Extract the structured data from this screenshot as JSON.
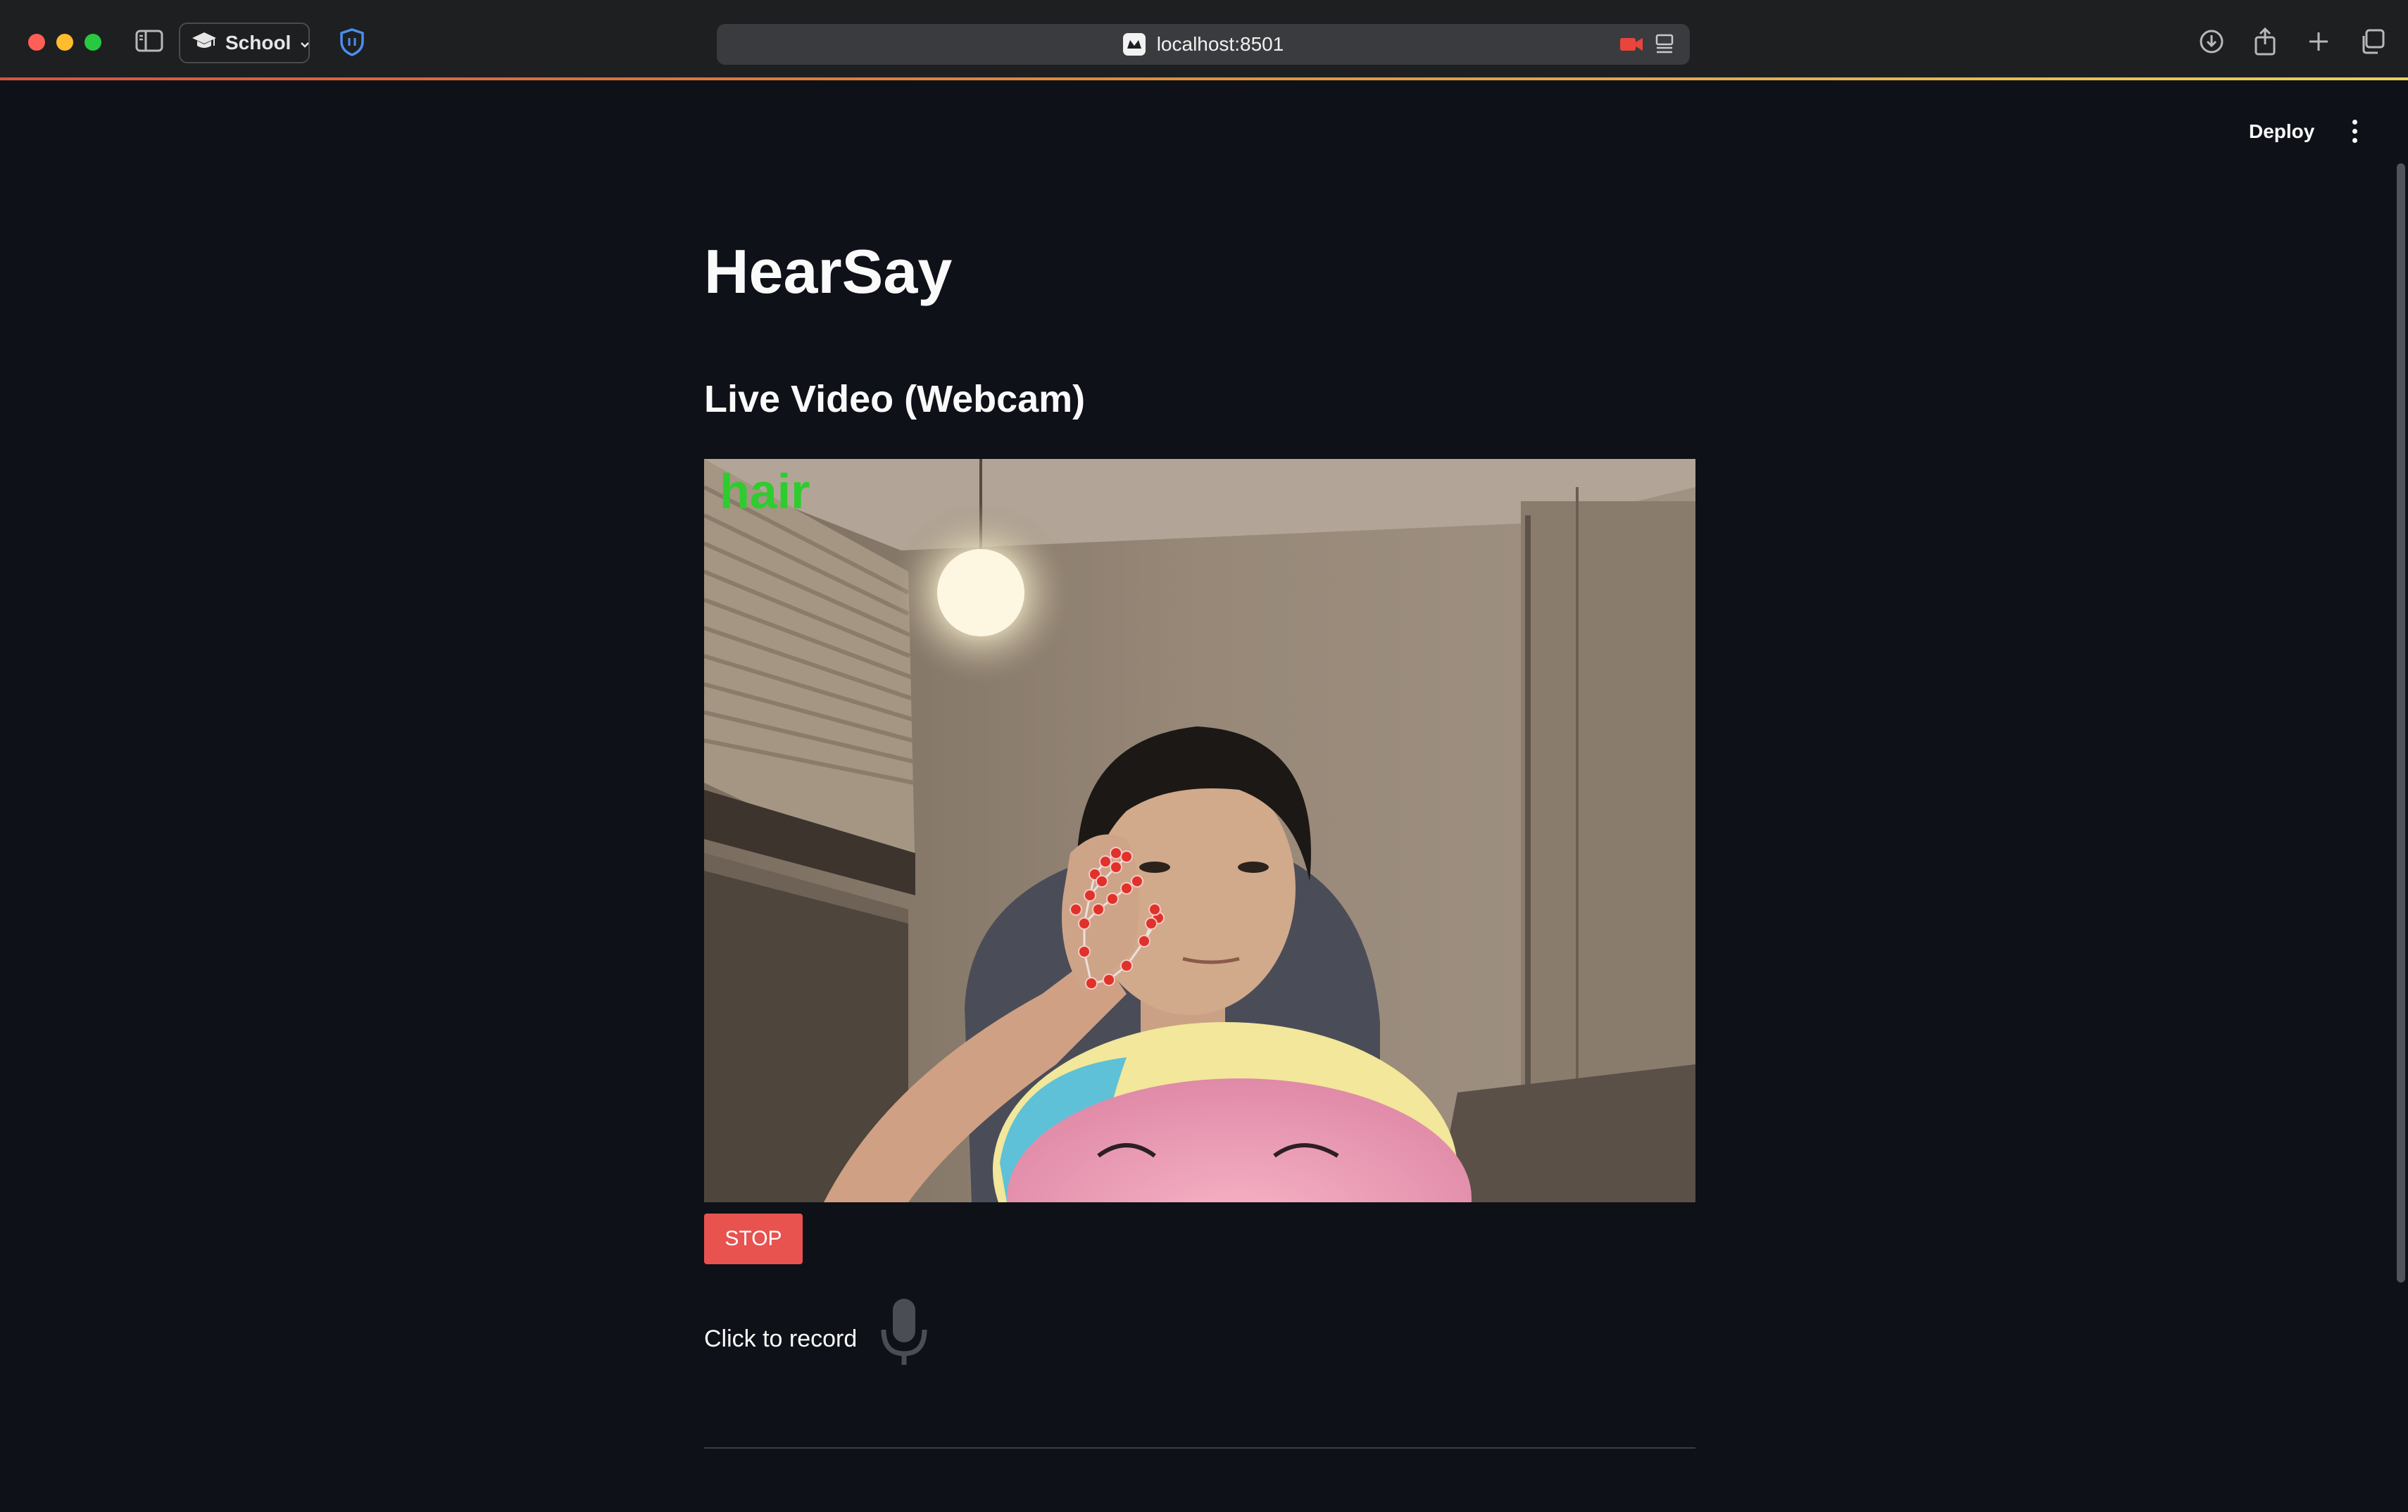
{
  "browser": {
    "profile_label": "School",
    "url": "localhost:8501"
  },
  "toolbar": {
    "deploy_label": "Deploy"
  },
  "main": {
    "title": "HearSay",
    "video_section_header": "Live Video (Webcam)",
    "prediction_overlay_text": "hair",
    "stop_button_label": "STOP",
    "record_label": "Click to record"
  },
  "colors": {
    "app_background": "#0e1117",
    "stop_button": "#e8524f",
    "prediction_text": "#2ecc2e",
    "hand_landmark": "#e0312a"
  },
  "icons": [
    "sidebar-icon",
    "graduation-cap-icon",
    "chevron-down-icon",
    "shield-icon",
    "camera-icon",
    "reader-icon",
    "download-icon",
    "share-icon",
    "plus-icon",
    "tabs-icon",
    "more-vert-icon",
    "microphone-icon"
  ]
}
